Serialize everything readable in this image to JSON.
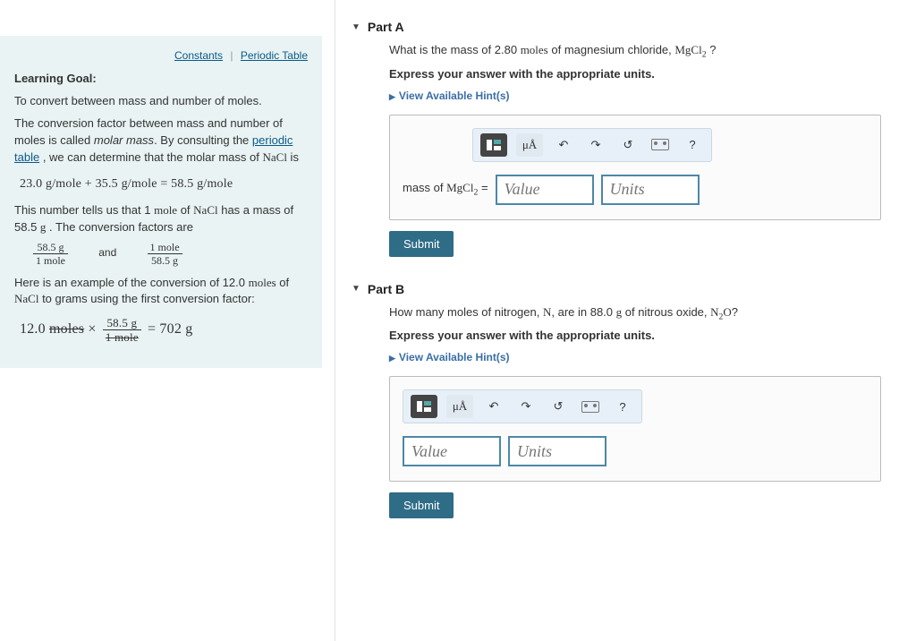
{
  "links": {
    "constants": "Constants",
    "ptable": "Periodic Table"
  },
  "lg": {
    "title": "Learning Goal:",
    "p1": "To convert between mass and number of moles.",
    "p2a": "The conversion factor between mass and number of moles is called ",
    "p2b": "molar mass",
    "p2c": ". By consulting the ",
    "p2d": "periodic table",
    "p2e": " , we can determine that the molar mass of ",
    "p2f": "NaCl",
    "p2g": " is",
    "eq1": "23.0 g/mole + 35.5 g/mole = 58.5 g/mole",
    "p3a": "This number tells us that 1 ",
    "p3b": "mole",
    "p3c": " of ",
    "p3d": "NaCl",
    "p3e": " has a mass of 58.5 ",
    "p3f": "g",
    "p3g": " . The conversion factors are",
    "cf1n": "58.5 g",
    "cf1d": "1 mole",
    "and": "and",
    "cf2n": "1 mole",
    "cf2d": "58.5 g",
    "p4a": "Here is an example of the conversion of 12.0 ",
    "p4b": "moles",
    "p4c": " of ",
    "p4d": "NaCl",
    "p4e": " to grams using the first conversion factor:",
    "eq2_left": "12.0 ",
    "eq2_strike1": "moles",
    "eq2_times": " × ",
    "eq2_num": "58.5 g",
    "eq2_den": "1 mole",
    "eq2_right": " = 702 g"
  },
  "partA": {
    "label": "Part A",
    "q1": "What is the mass of 2.80 ",
    "q2": "moles",
    "q3": " of magnesium chloride, ",
    "q4": "MgCl",
    "q5": " ?",
    "instr": "Express your answer with the appropriate units.",
    "hints": "View Available Hint(s)",
    "inputLabel1": "mass of ",
    "inputLabel2": "MgCl",
    "inputLabel3": " =",
    "valuePH": "Value",
    "unitsPH": "Units",
    "submit": "Submit"
  },
  "partB": {
    "label": "Part B",
    "q1": "How many moles of nitrogen, ",
    "q2": "N",
    "q3": ", are in 88.0 ",
    "q4": "g",
    "q5": " of nitrous oxide, ",
    "q6": "N",
    "q7": "O",
    "q8": "?",
    "instr": "Express your answer with the appropriate units.",
    "hints": "View Available Hint(s)",
    "valuePH": "Value",
    "unitsPH": "Units",
    "submit": "Submit"
  },
  "toolbar": {
    "units": "μÅ",
    "help": "?"
  }
}
